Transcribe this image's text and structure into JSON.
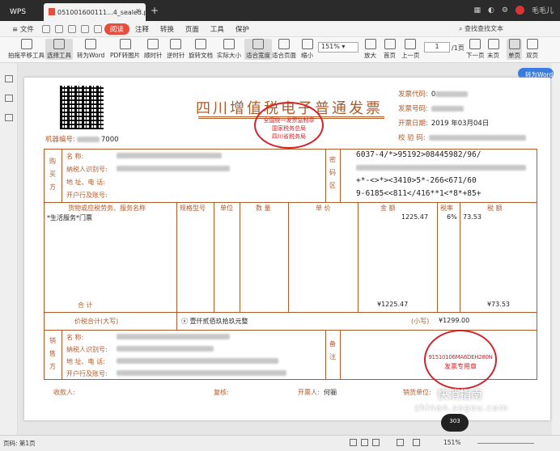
{
  "titlebar": {
    "app_tab": "WPS",
    "doc_tab": "051001600111...4_sealed.pdf",
    "new_tab": "+",
    "user": "毛毛儿"
  },
  "menubar": {
    "file": "≡ 文件",
    "read": "阅读",
    "items": [
      "注释",
      "转换",
      "页面",
      "工具",
      "保护"
    ],
    "search": "查找查找文本"
  },
  "toolbar": {
    "hand": "拍拖平移工具",
    "select": "选择工具",
    "to_word": "转为Word",
    "pdf_img": "PDF转图片",
    "rot_l": "顺时针",
    "rot_r": "逆时针",
    "rotate_doc": "旋转文档",
    "actual": "实际大小",
    "fit_w": "适合宽度",
    "fit_p": "适合页面",
    "zoom_out": "缩小",
    "zoom_val": "151%",
    "zoom_in": "放大",
    "first": "首页",
    "prev": "上一页",
    "page": "1",
    "of": "/1页",
    "next": "下一页",
    "last": "末页",
    "single": "单页",
    "double": "双页"
  },
  "to_word_btn": "转为Word",
  "invoice": {
    "title": "四川增值税电子普通发票",
    "seal1_a": "全国统一发票监制章",
    "seal1_b": "国家税务总局",
    "seal1_c": "四川省税务局",
    "code_lbl": "发票代码:",
    "code_val": "0",
    "no_lbl": "发票号码:",
    "date_lbl": "开票日期:",
    "date_val": "2019 年03月04日",
    "check_lbl": "校 验 码:",
    "machine_lbl": "机器编号:",
    "machine_val": "7000",
    "buyer_vert": "购买方",
    "name_lbl": "名      称:",
    "taxid_lbl": "纳税人识别号:",
    "addr_lbl": "地 址、电 话:",
    "bank_lbl": "开户行及账号:",
    "pwd_vert": "密码区",
    "cipher": [
      "6037-4/*>95192>08445982/96/",
      "",
      "+*-<>*><3410>5*-266<671/60",
      "9-6185<<811</416**1<*8*+85+"
    ],
    "col_goods": "货物或应税劳务、服务名称",
    "col_spec": "规格型号",
    "col_unit": "单位",
    "col_qty": "数 量",
    "col_price": "单 价",
    "col_amount": "金 额",
    "col_rate": "税率",
    "col_tax": "税 额",
    "item_name": "*生活服务*门票",
    "item_amount": "1225.47",
    "item_rate": "6%",
    "item_tax": "73.53",
    "total_lbl": "合 计",
    "total_amount": "¥1225.47",
    "total_tax": "¥73.53",
    "sum_lbl": "价税合计(大写)",
    "sum_words": "ⓧ 壹仟贰佰玖拾玖元整",
    "sum_small_lbl": "(小写)",
    "sum_small": "¥1299.00",
    "seller_vert": "销售方",
    "remark_vert": "备注",
    "seal2_a": "91510106MA6DEH280N",
    "seal2_b": "发票专用章",
    "payee_lbl": "收款人:",
    "review_lbl": "复核:",
    "drawer_lbl": "开票人:",
    "drawer_val": "何骊",
    "seller_sign_lbl": "销货单位:"
  },
  "watermark": {
    "logo": "快消指南",
    "url": "zhinan.sogou.com",
    "badge": "303"
  },
  "statusbar": {
    "page": "页码: 第1页",
    "zoom": "151%"
  }
}
